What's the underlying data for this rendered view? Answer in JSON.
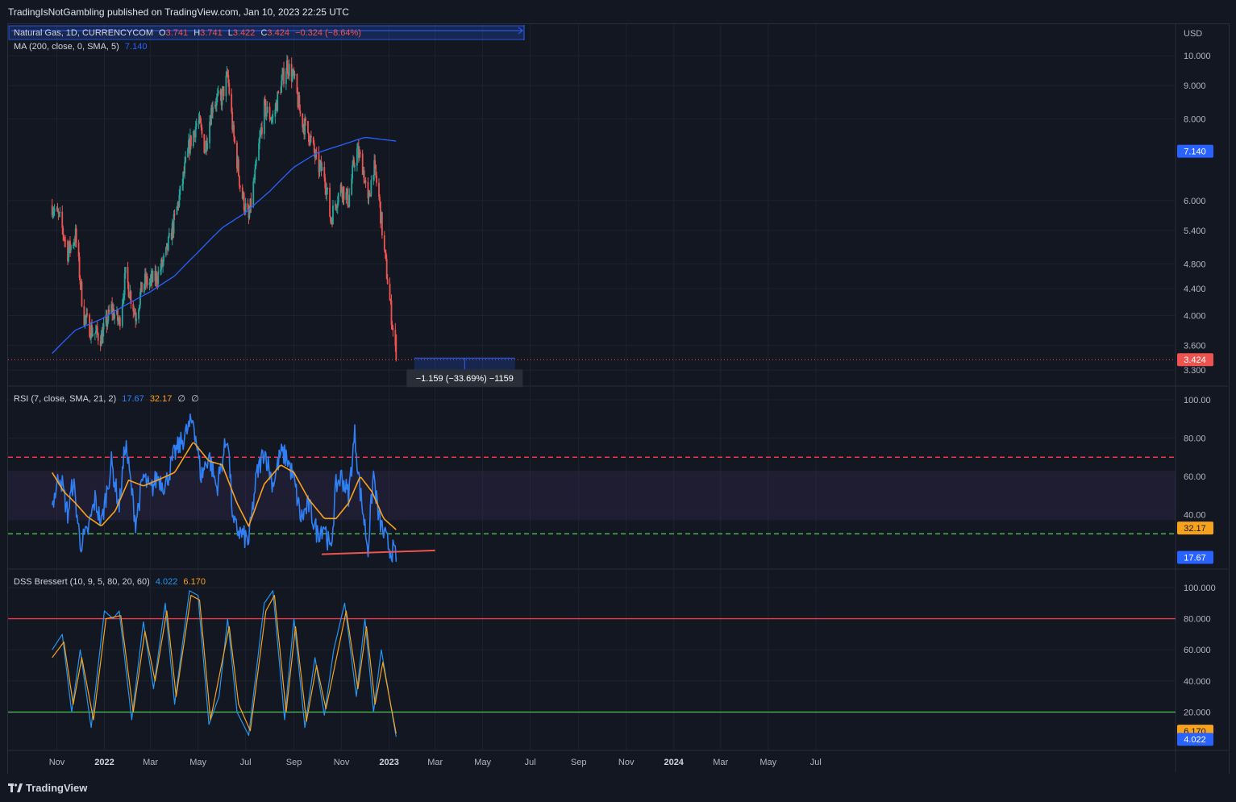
{
  "header": {
    "published": "TradingIsNotGambling published on TradingView.com, Jan 10, 2023 22:25 UTC"
  },
  "footer": {
    "brand": "TradingView"
  },
  "colors": {
    "background": "#131722",
    "grid": "#1e222d",
    "up": "#26a69a",
    "down": "#ef5350",
    "ma": "#2962ff",
    "rsi": "#2f7ff5",
    "rsi_sma": "#f7a21b",
    "dss_fast": "#2196f3",
    "dss_slow": "#f7a21b",
    "upper_band": "#f23645",
    "lower_band": "#4caf50"
  },
  "legend": {
    "main": {
      "symbol": "Natural Gas, 1D, CURRENCYCOM",
      "o_label": "O",
      "o": "3.741",
      "h_label": "H",
      "h": "3.741",
      "l_label": "L",
      "l": "3.422",
      "c_label": "C",
      "c": "3.424",
      "change": "−0.324 (−8.64%)"
    },
    "ma": {
      "label": "MA (200, close, 0, SMA, 5)",
      "value": "7.140"
    },
    "rsi": {
      "label": "RSI (7, close, SMA, 21, 2)",
      "v1": "17.67",
      "v2": "32.17",
      "v3": "∅",
      "v4": "∅"
    },
    "dss": {
      "label": "DSS Bressert (10, 9, 5, 80, 20, 60)",
      "v1": "4.022",
      "v2": "6.170"
    }
  },
  "measure": {
    "label": "−1.159 (−33.69%) −1159"
  },
  "chart_data": [
    {
      "type": "candlestick",
      "pane": "price",
      "currency": "USD",
      "scale": "log",
      "ylim": [
        3.2,
        10.5
      ],
      "y_ticks": [
        "10.000",
        "9.000",
        "8.000",
        "6.000",
        "5.400",
        "4.800",
        "4.400",
        "4.000",
        "3.600",
        "3.300"
      ],
      "x_ticks": [
        "Nov",
        "2022",
        "Mar",
        "May",
        "Jul",
        "Sep",
        "Nov",
        "2023",
        "Mar",
        "May",
        "Jul",
        "Sep",
        "Nov",
        "2024",
        "Mar",
        "May",
        "Jul"
      ],
      "close_path": [
        [
          "2021-10-26",
          5.9
        ],
        [
          "2021-11-05",
          5.6
        ],
        [
          "2021-11-15",
          5.0
        ],
        [
          "2021-11-25",
          5.3
        ],
        [
          "2021-12-05",
          4.0
        ],
        [
          "2021-12-15",
          3.8
        ],
        [
          "2021-12-28",
          3.7
        ],
        [
          "2022-01-10",
          4.1
        ],
        [
          "2022-01-20",
          3.9
        ],
        [
          "2022-01-28",
          4.6
        ],
        [
          "2022-02-10",
          4.0
        ],
        [
          "2022-02-20",
          4.5
        ],
        [
          "2022-03-01",
          4.5
        ],
        [
          "2022-03-10",
          4.6
        ],
        [
          "2022-03-20",
          4.9
        ],
        [
          "2022-04-01",
          5.6
        ],
        [
          "2022-04-10",
          6.3
        ],
        [
          "2022-04-20",
          7.3
        ],
        [
          "2022-05-01",
          8.0
        ],
        [
          "2022-05-10",
          7.2
        ],
        [
          "2022-05-20",
          8.5
        ],
        [
          "2022-05-31",
          8.6
        ],
        [
          "2022-06-08",
          9.3
        ],
        [
          "2022-06-15",
          7.6
        ],
        [
          "2022-06-25",
          6.2
        ],
        [
          "2022-07-05",
          5.6
        ],
        [
          "2022-07-15",
          6.8
        ],
        [
          "2022-07-25",
          8.3
        ],
        [
          "2022-08-05",
          8.0
        ],
        [
          "2022-08-15",
          9.0
        ],
        [
          "2022-08-23",
          9.7
        ],
        [
          "2022-09-01",
          9.2
        ],
        [
          "2022-09-10",
          8.0
        ],
        [
          "2022-09-20",
          7.6
        ],
        [
          "2022-10-01",
          6.8
        ],
        [
          "2022-10-10",
          6.6
        ],
        [
          "2022-10-18",
          5.6
        ],
        [
          "2022-10-25",
          6.0
        ],
        [
          "2022-11-01",
          6.3
        ],
        [
          "2022-11-10",
          6.0
        ],
        [
          "2022-11-20",
          7.2
        ],
        [
          "2022-11-28",
          6.8
        ],
        [
          "2022-12-05",
          5.9
        ],
        [
          "2022-12-12",
          6.8
        ],
        [
          "2022-12-18",
          6.2
        ],
        [
          "2022-12-25",
          5.1
        ],
        [
          "2023-01-02",
          4.2
        ],
        [
          "2023-01-06",
          3.8
        ],
        [
          "2023-01-10",
          3.424
        ]
      ],
      "ma200_path": [
        [
          "2021-10-26",
          3.5
        ],
        [
          "2021-11-25",
          3.8
        ],
        [
          "2021-12-28",
          3.95
        ],
        [
          "2022-01-28",
          4.15
        ],
        [
          "2022-03-01",
          4.35
        ],
        [
          "2022-04-01",
          4.6
        ],
        [
          "2022-05-01",
          5.0
        ],
        [
          "2022-06-01",
          5.45
        ],
        [
          "2022-07-01",
          5.75
        ],
        [
          "2022-08-01",
          6.2
        ],
        [
          "2022-09-01",
          6.75
        ],
        [
          "2022-10-01",
          7.1
        ],
        [
          "2022-11-01",
          7.3
        ],
        [
          "2022-12-01",
          7.5
        ],
        [
          "2023-01-10",
          7.4
        ]
      ],
      "last_price": 3.424,
      "ma_last": 7.14,
      "measurement": {
        "start": "2023-01-10",
        "end": "2023-06-12",
        "from": 4.583,
        "to": 3.424,
        "change": -1.159,
        "change_pct": -33.69
      }
    },
    {
      "type": "line",
      "pane": "rsi",
      "ylim": [
        12,
        100
      ],
      "y_ticks": [
        "100.00",
        "80.00",
        "60.00",
        "40.00"
      ],
      "bands": {
        "upper": 70,
        "lower": 30,
        "fill_top": 63,
        "fill_bottom": 37
      },
      "series": [
        {
          "values": [
            [
              "2021-10-26",
              45
            ],
            [
              "2021-11-05",
              62
            ],
            [
              "2021-11-15",
              40
            ],
            [
              "2021-11-22",
              58
            ],
            [
              "2021-12-01",
              25
            ],
            [
              "2021-12-10",
              30
            ],
            [
              "2021-12-20",
              48
            ],
            [
              "2021-12-28",
              35
            ],
            [
              "2022-01-10",
              67
            ],
            [
              "2022-01-20",
              44
            ],
            [
              "2022-01-28",
              78
            ],
            [
              "2022-02-10",
              36
            ],
            [
              "2022-02-20",
              60
            ],
            [
              "2022-03-01",
              52
            ],
            [
              "2022-03-10",
              60
            ],
            [
              "2022-03-20",
              55
            ],
            [
              "2022-04-01",
              72
            ],
            [
              "2022-04-10",
              78
            ],
            [
              "2022-04-25",
              90
            ],
            [
              "2022-05-05",
              60
            ],
            [
              "2022-05-15",
              71
            ],
            [
              "2022-05-25",
              54
            ],
            [
              "2022-06-08",
              82
            ],
            [
              "2022-06-15",
              35
            ],
            [
              "2022-06-25",
              30
            ],
            [
              "2022-07-05",
              26
            ],
            [
              "2022-07-15",
              60
            ],
            [
              "2022-07-25",
              74
            ],
            [
              "2022-08-05",
              56
            ],
            [
              "2022-08-15",
              72
            ],
            [
              "2022-08-23",
              70
            ],
            [
              "2022-09-01",
              58
            ],
            [
              "2022-09-10",
              38
            ],
            [
              "2022-09-20",
              45
            ],
            [
              "2022-10-01",
              30
            ],
            [
              "2022-10-10",
              35
            ],
            [
              "2022-10-18",
              20
            ],
            [
              "2022-10-25",
              55
            ],
            [
              "2022-11-01",
              60
            ],
            [
              "2022-11-10",
              50
            ],
            [
              "2022-11-18",
              82
            ],
            [
              "2022-11-25",
              52
            ],
            [
              "2022-12-05",
              22
            ],
            [
              "2022-12-12",
              62
            ],
            [
              "2022-12-18",
              40
            ],
            [
              "2022-12-25",
              30
            ],
            [
              "2023-01-02",
              22
            ],
            [
              "2023-01-06",
              21
            ],
            [
              "2023-01-10",
              17.67
            ]
          ]
        },
        {
          "values": [
            [
              "2021-10-26",
              62
            ],
            [
              "2021-11-10",
              52
            ],
            [
              "2021-11-25",
              46
            ],
            [
              "2021-12-10",
              39
            ],
            [
              "2021-12-28",
              34
            ],
            [
              "2022-01-15",
              42
            ],
            [
              "2022-02-01",
              58
            ],
            [
              "2022-02-20",
              55
            ],
            [
              "2022-03-10",
              58
            ],
            [
              "2022-04-01",
              62
            ],
            [
              "2022-04-25",
              78
            ],
            [
              "2022-05-15",
              68
            ],
            [
              "2022-06-01",
              66
            ],
            [
              "2022-06-20",
              46
            ],
            [
              "2022-07-05",
              34
            ],
            [
              "2022-07-25",
              56
            ],
            [
              "2022-08-15",
              66
            ],
            [
              "2022-09-01",
              62
            ],
            [
              "2022-09-20",
              48
            ],
            [
              "2022-10-10",
              38
            ],
            [
              "2022-10-25",
              38
            ],
            [
              "2022-11-10",
              46
            ],
            [
              "2022-11-25",
              60
            ],
            [
              "2022-12-10",
              52
            ],
            [
              "2022-12-25",
              38
            ],
            [
              "2023-01-10",
              32.17
            ]
          ]
        }
      ],
      "trendline": {
        "from": [
          "2022-10-18",
          21
        ],
        "to": [
          "2023-03-01",
          23
        ]
      },
      "last_values": [
        17.67,
        32.17
      ]
    },
    {
      "type": "line",
      "pane": "dss",
      "ylim": [
        0,
        100
      ],
      "y_ticks": [
        "100.000",
        "80.000",
        "60.000",
        "40.000",
        "20.000"
      ],
      "bands": {
        "upper": 80,
        "lower": 20
      },
      "series": [
        {
          "values": [
            [
              "2021-10-26",
              60
            ],
            [
              "2021-11-08",
              70
            ],
            [
              "2021-11-20",
              20
            ],
            [
              "2021-12-01",
              60
            ],
            [
              "2021-12-15",
              10
            ],
            [
              "2022-01-01",
              85
            ],
            [
              "2022-01-12",
              80
            ],
            [
              "2022-01-20",
              85
            ],
            [
              "2022-02-05",
              15
            ],
            [
              "2022-02-20",
              78
            ],
            [
              "2022-03-05",
              35
            ],
            [
              "2022-03-20",
              90
            ],
            [
              "2022-04-01",
              25
            ],
            [
              "2022-04-20",
              98
            ],
            [
              "2022-05-01",
              95
            ],
            [
              "2022-05-15",
              12
            ],
            [
              "2022-05-28",
              30
            ],
            [
              "2022-06-08",
              80
            ],
            [
              "2022-06-20",
              20
            ],
            [
              "2022-07-05",
              5
            ],
            [
              "2022-07-25",
              90
            ],
            [
              "2022-08-05",
              98
            ],
            [
              "2022-08-20",
              15
            ],
            [
              "2022-09-01",
              80
            ],
            [
              "2022-09-15",
              10
            ],
            [
              "2022-09-28",
              55
            ],
            [
              "2022-10-10",
              18
            ],
            [
              "2022-10-22",
              60
            ],
            [
              "2022-11-05",
              90
            ],
            [
              "2022-11-20",
              30
            ],
            [
              "2022-12-01",
              80
            ],
            [
              "2022-12-12",
              20
            ],
            [
              "2022-12-22",
              60
            ],
            [
              "2023-01-10",
              4.022
            ]
          ]
        },
        {
          "values": [
            [
              "2021-10-26",
              55
            ],
            [
              "2021-11-10",
              65
            ],
            [
              "2021-11-22",
              25
            ],
            [
              "2021-12-03",
              55
            ],
            [
              "2021-12-18",
              15
            ],
            [
              "2022-01-03",
              80
            ],
            [
              "2022-01-22",
              82
            ],
            [
              "2022-02-07",
              20
            ],
            [
              "2022-02-22",
              72
            ],
            [
              "2022-03-07",
              40
            ],
            [
              "2022-03-22",
              85
            ],
            [
              "2022-04-03",
              30
            ],
            [
              "2022-04-22",
              95
            ],
            [
              "2022-05-03",
              92
            ],
            [
              "2022-05-17",
              15
            ],
            [
              "2022-06-10",
              75
            ],
            [
              "2022-06-22",
              25
            ],
            [
              "2022-07-07",
              8
            ],
            [
              "2022-07-27",
              85
            ],
            [
              "2022-08-07",
              95
            ],
            [
              "2022-08-22",
              20
            ],
            [
              "2022-09-03",
              75
            ],
            [
              "2022-09-17",
              14
            ],
            [
              "2022-09-30",
              50
            ],
            [
              "2022-10-12",
              22
            ],
            [
              "2022-11-07",
              85
            ],
            [
              "2022-11-22",
              35
            ],
            [
              "2022-12-03",
              75
            ],
            [
              "2022-12-14",
              25
            ],
            [
              "2022-12-24",
              52
            ],
            [
              "2023-01-10",
              6.17
            ]
          ]
        }
      ],
      "last_values": [
        4.022,
        6.17
      ]
    }
  ]
}
